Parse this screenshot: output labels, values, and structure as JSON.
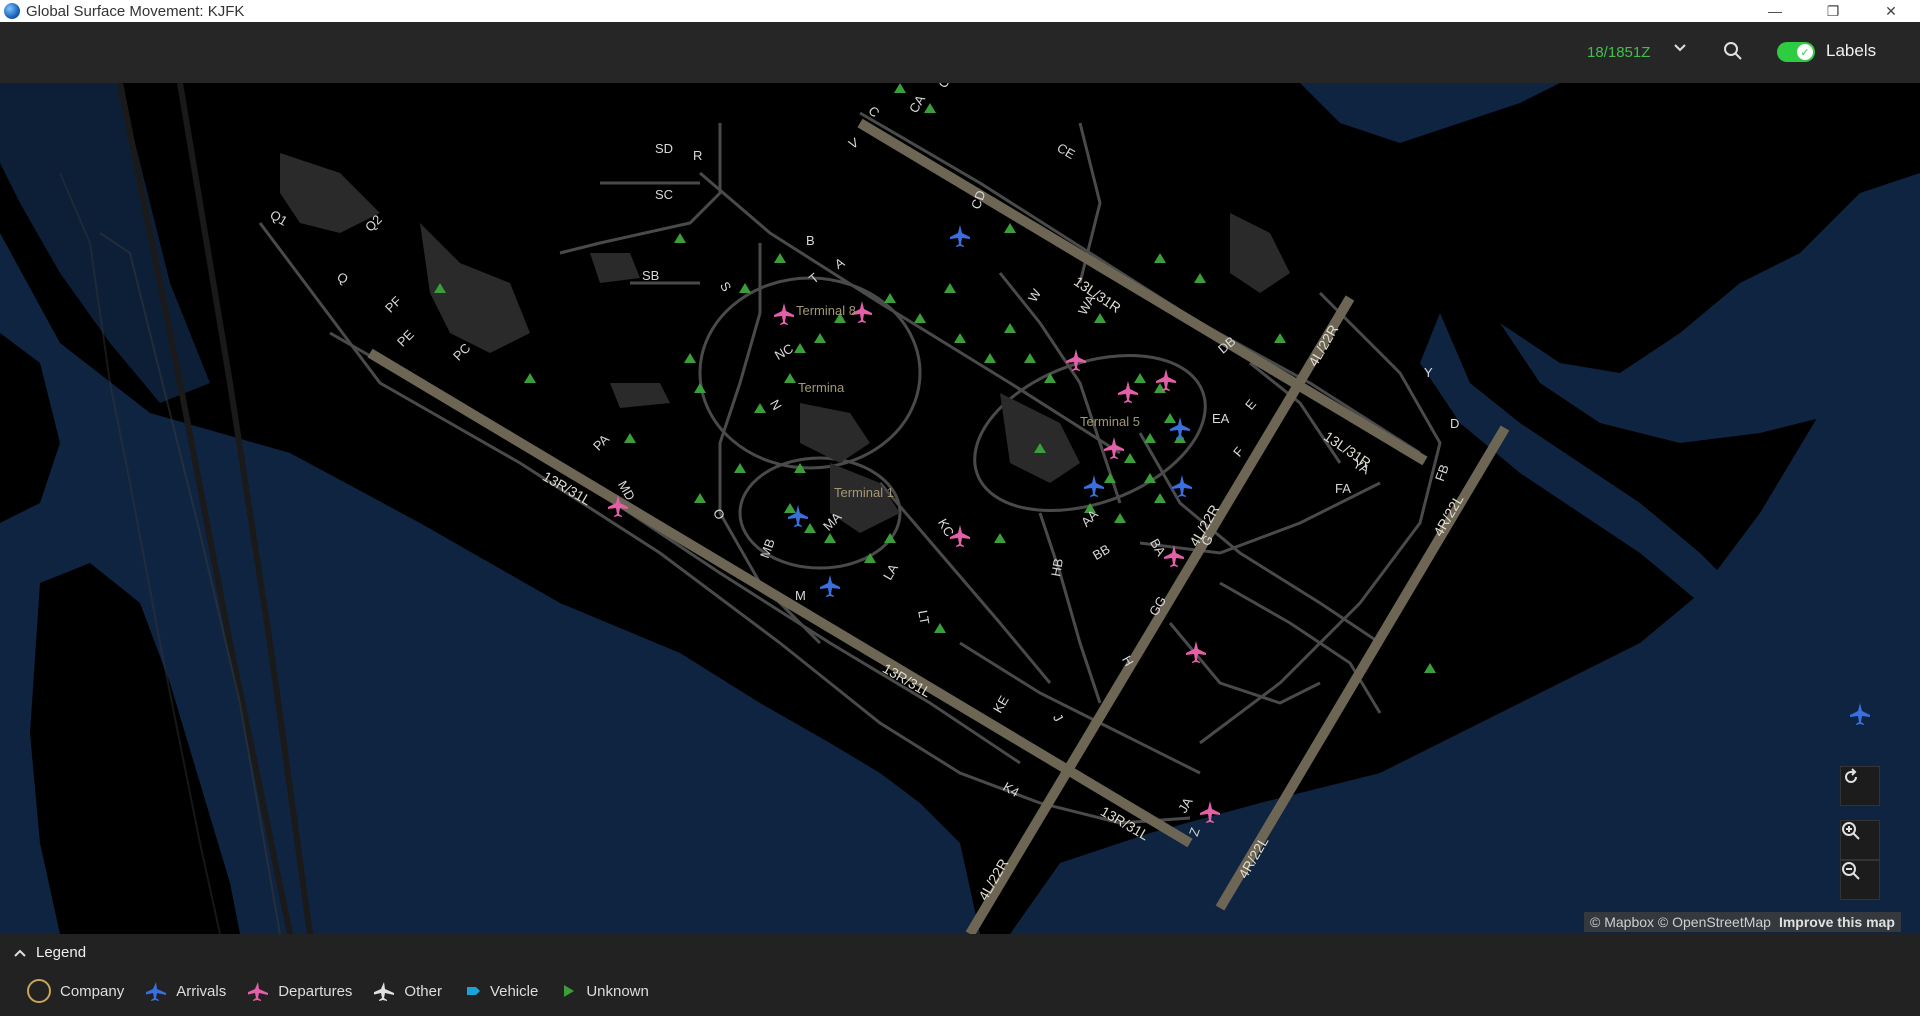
{
  "window": {
    "title": "Global Surface Movement: KJFK"
  },
  "toolbar": {
    "time": "18/1851Z",
    "labels_toggle": "Labels",
    "labels_on": true
  },
  "map": {
    "taxiway_labels": [
      {
        "t": "SD"
      },
      {
        "t": "SC"
      },
      {
        "t": "SB"
      },
      {
        "t": "R"
      },
      {
        "t": "Q1"
      },
      {
        "t": "Q2"
      },
      {
        "t": "Q"
      },
      {
        "t": "PF"
      },
      {
        "t": "PE"
      },
      {
        "t": "PC"
      },
      {
        "t": "PA"
      },
      {
        "t": "MD"
      },
      {
        "t": "MB"
      },
      {
        "t": "MA"
      },
      {
        "t": "M"
      },
      {
        "t": "C"
      },
      {
        "t": "CA"
      },
      {
        "t": "CB"
      },
      {
        "t": "CE"
      },
      {
        "t": "CD"
      },
      {
        "t": "B"
      },
      {
        "t": "A"
      },
      {
        "t": "T"
      },
      {
        "t": "S"
      },
      {
        "t": "NC"
      },
      {
        "t": "N"
      },
      {
        "t": "W"
      },
      {
        "t": "WA"
      },
      {
        "t": "DB"
      },
      {
        "t": "E"
      },
      {
        "t": "EA"
      },
      {
        "t": "F"
      },
      {
        "t": "FA"
      },
      {
        "t": "FB"
      },
      {
        "t": "Y"
      },
      {
        "t": "YA"
      },
      {
        "t": "G"
      },
      {
        "t": "GG"
      },
      {
        "t": "BB"
      },
      {
        "t": "AA"
      },
      {
        "t": "HB"
      },
      {
        "t": "H"
      },
      {
        "t": "J"
      },
      {
        "t": "JA"
      },
      {
        "t": "Z"
      },
      {
        "t": "K4"
      },
      {
        "t": "KE"
      },
      {
        "t": "LT"
      },
      {
        "t": "LA"
      },
      {
        "t": "KC"
      },
      {
        "t": "V"
      },
      {
        "t": "O"
      },
      {
        "t": "D"
      },
      {
        "t": "BA"
      }
    ],
    "runway_labels": [
      {
        "t": "13L/31R"
      },
      {
        "t": "13L/31R"
      },
      {
        "t": "4L/22R"
      },
      {
        "t": "4L/22R"
      },
      {
        "t": "4L/22R"
      },
      {
        "t": "13R/31L"
      },
      {
        "t": "13R/31L"
      },
      {
        "t": "13R/31L"
      },
      {
        "t": "4R/22L"
      },
      {
        "t": "4R/22L"
      }
    ],
    "terminals": [
      "Terminal 8",
      "Terminal 5",
      "Terminal 1",
      "Termina"
    ],
    "attribution": {
      "mapbox": "© Mapbox",
      "osm": "© OpenStreetMap",
      "improve": "Improve this map"
    }
  },
  "legend": {
    "title": "Legend",
    "items": [
      {
        "label": "Company",
        "icon": "company-ring-icon",
        "color": "#c9a35a"
      },
      {
        "label": "Arrivals",
        "icon": "airplane-icon",
        "color": "#3a6fe0"
      },
      {
        "label": "Departures",
        "icon": "airplane-icon",
        "color": "#e35fa8"
      },
      {
        "label": "Other",
        "icon": "airplane-icon",
        "color": "#e0e0e0"
      },
      {
        "label": "Vehicle",
        "icon": "vehicle-icon",
        "color": "#1aa3d9"
      },
      {
        "label": "Unknown",
        "icon": "triangle-icon",
        "color": "#3b9e3b"
      }
    ]
  },
  "colors": {
    "water": "#0f2440",
    "land": "#000000",
    "taxiway": "#4a4a4a",
    "runway": "#6d6655",
    "terminal_text": "#a39774",
    "arrival": "#3a6fe0",
    "departure": "#e35fa8",
    "unknown": "#3b9e3b",
    "time": "#3fbf4a"
  }
}
